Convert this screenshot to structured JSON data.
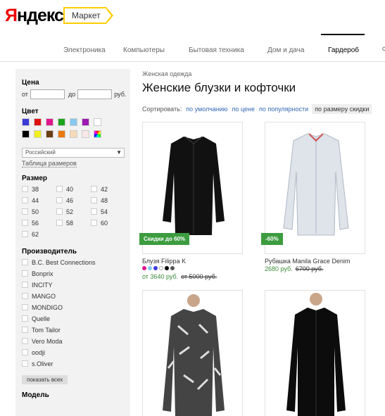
{
  "header": {
    "logo_first": "Я",
    "logo_rest": "ндекс",
    "market_label": "Маркет"
  },
  "nav": {
    "items": [
      "Электроника",
      "Компьютеры",
      "Бытовая техника",
      "Дом и дача",
      "Гардероб"
    ],
    "active": "Гардероб",
    "more": "с"
  },
  "filters": {
    "price_heading": "Цена",
    "price_from": "от",
    "price_to": "до",
    "price_unit": "руб.",
    "color_heading": "Цвет",
    "colors": [
      "#3b3bd9",
      "#e01010",
      "#e0168d",
      "#1aa51a",
      "#86c8f0",
      "#9b1ab0",
      "#ffffff",
      "#000000",
      "#f0f020",
      "#6b3d10",
      "#e87a10",
      "#f5d9b8",
      "#f8e8e8",
      "multicolor"
    ],
    "size_system": "Российский",
    "size_table_link": "Таблица размеров",
    "size_heading": "Размер",
    "sizes": [
      "38",
      "40",
      "42",
      "44",
      "46",
      "48",
      "50",
      "52",
      "54",
      "56",
      "58",
      "60",
      "62"
    ],
    "brand_heading": "Производитель",
    "brands": [
      "B.C. Best Connections",
      "Bonprix",
      "INCITY",
      "MANGO",
      "MONDIGO",
      "Quelle",
      "Tom Tailor",
      "Vero Moda",
      "oodji",
      "s.Oliver"
    ],
    "show_all": "показать всех",
    "model_heading": "Модель"
  },
  "main": {
    "breadcrumb": "Женская одежда",
    "title": "Женские блузки и кофточки",
    "sort_label": "Сортировать:",
    "sort_options": [
      "по умолчанию",
      "по цене",
      "по популярности",
      "по размеру скидки"
    ],
    "sort_active": "по размеру скидки"
  },
  "products": [
    {
      "badge": "Скидки до 60%",
      "name": "Блузя Filippa K",
      "price_now": "от 3640 руб.",
      "price_old": "от 5000 руб.",
      "variant_colors": [
        "#e0168d",
        "#86c8f0",
        "#3b3bd9",
        "#ffffff",
        "#000000",
        "#555555"
      ]
    },
    {
      "badge": "-60%",
      "name": "Рубашка Manila Grace Denim",
      "price_now": "2680 руб.",
      "price_old": "6700 руб."
    }
  ]
}
